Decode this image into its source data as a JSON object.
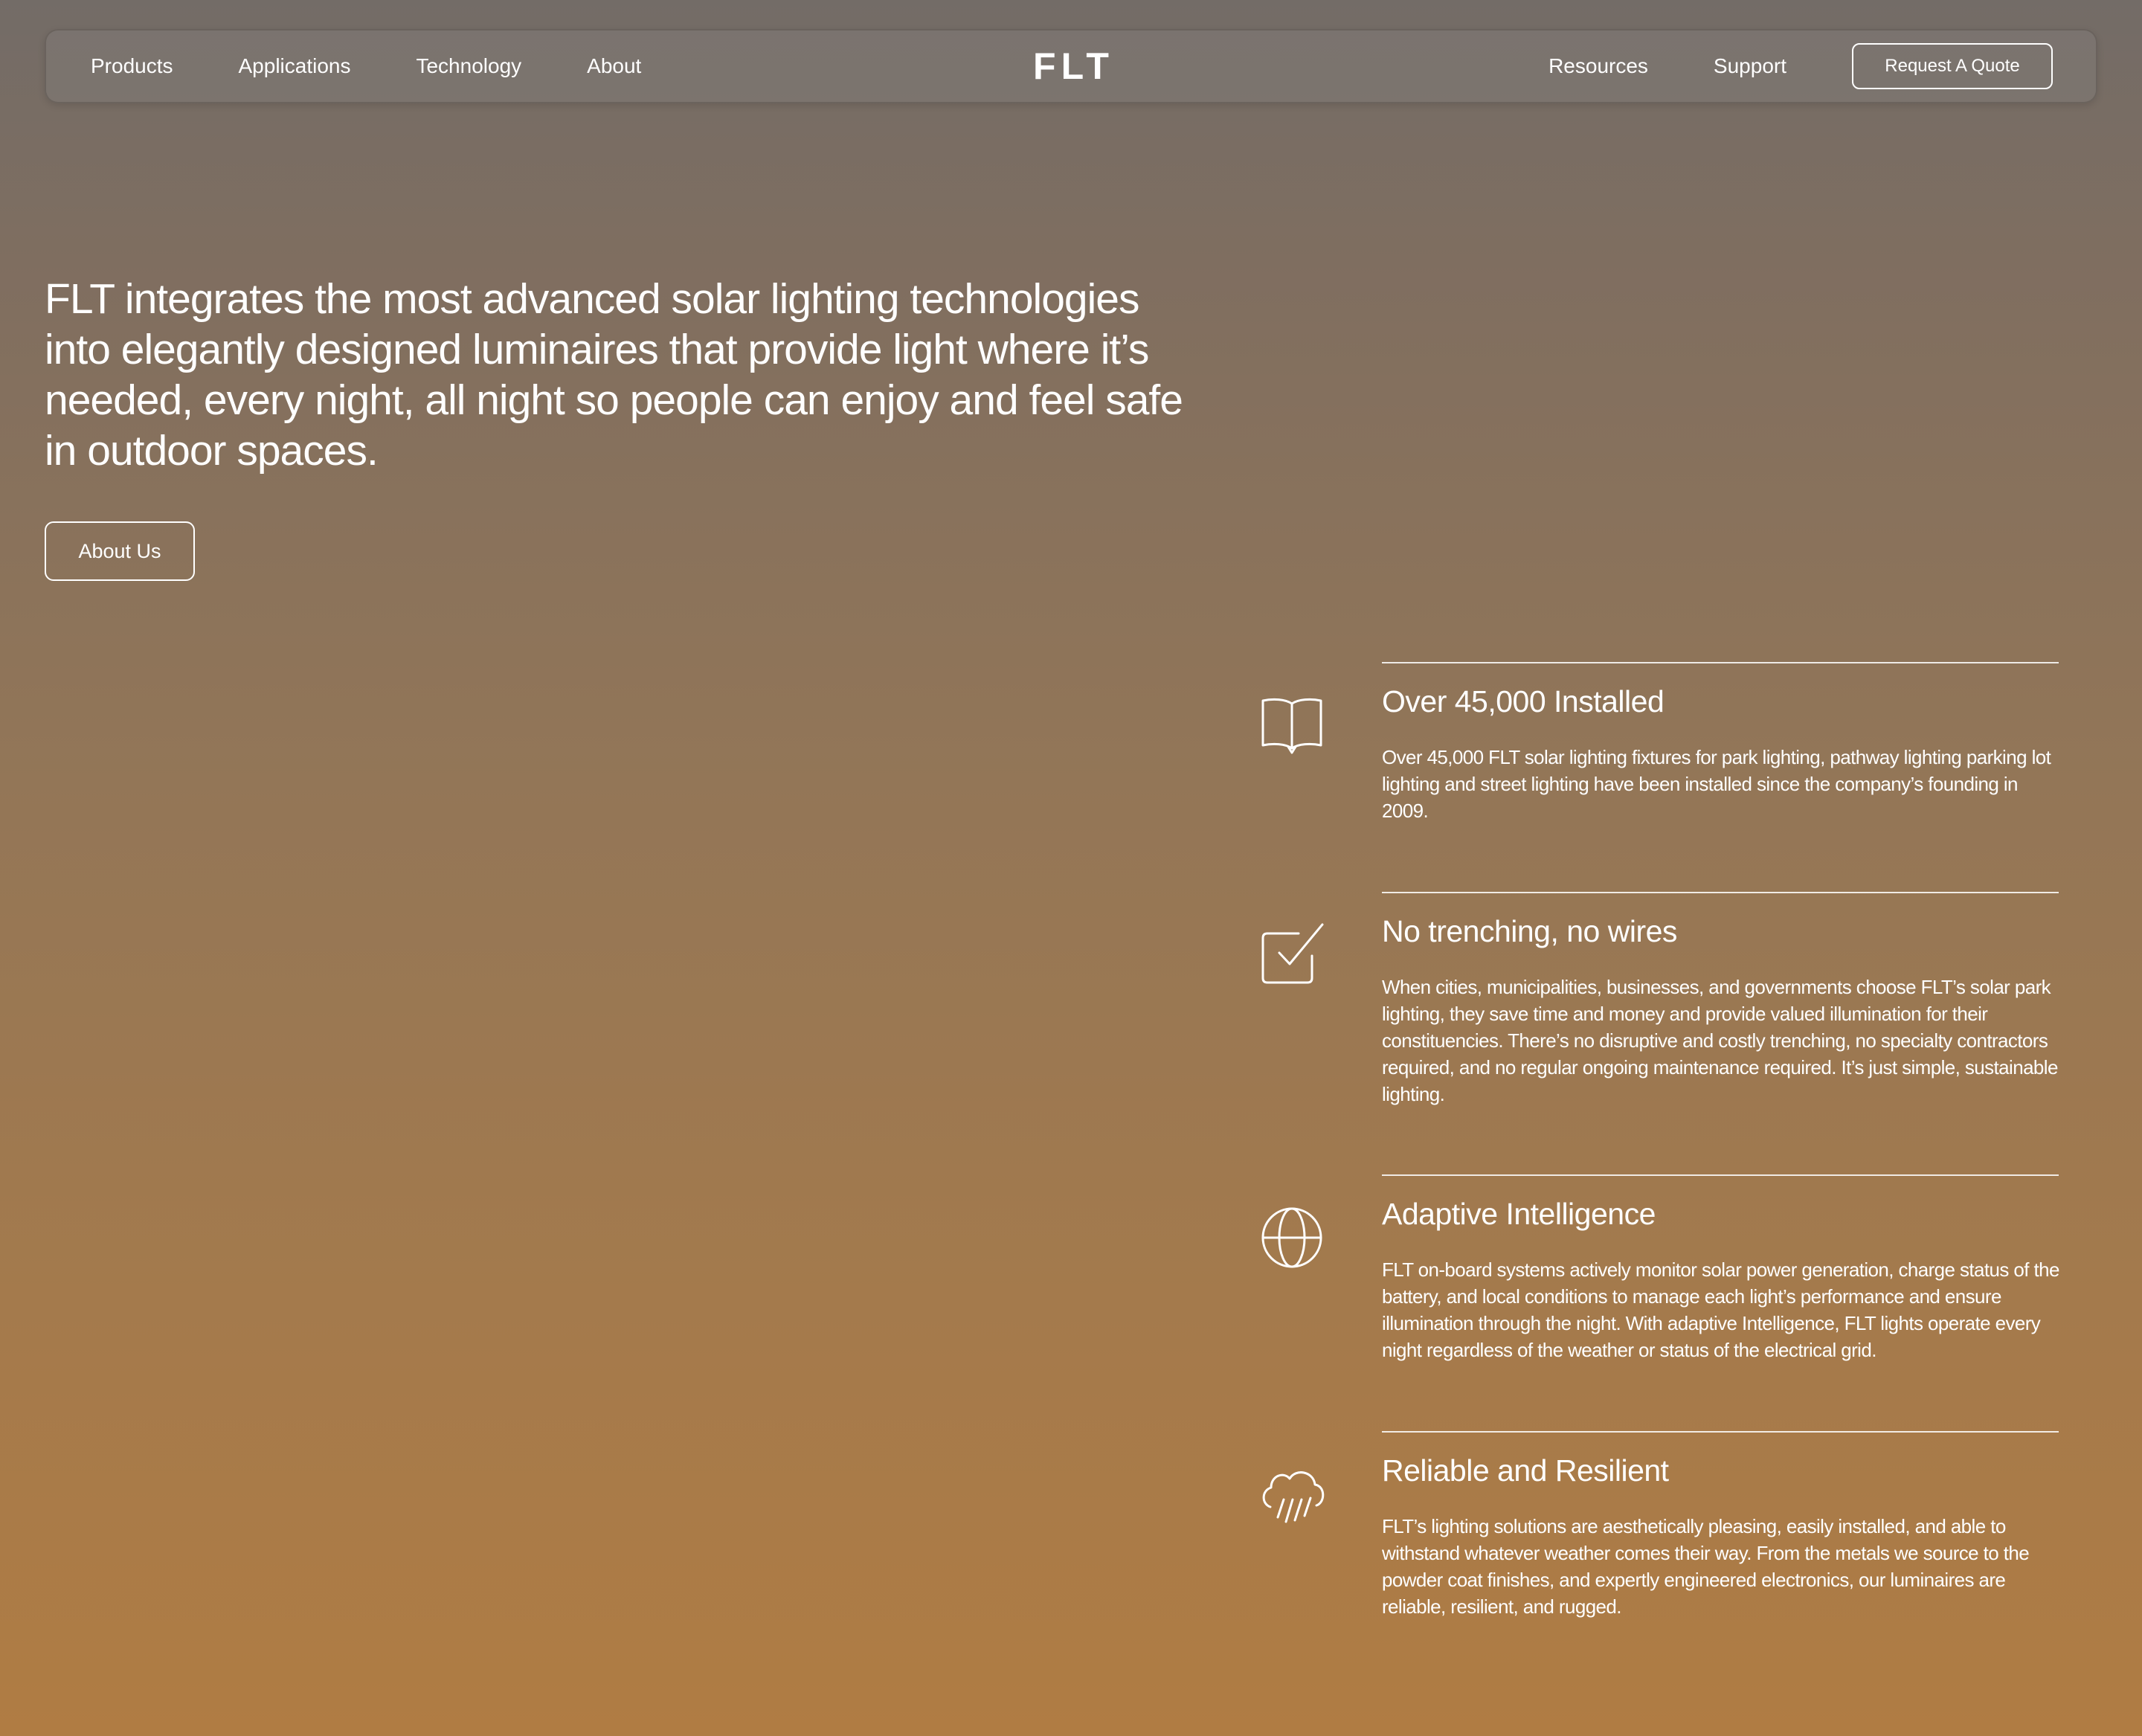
{
  "nav": {
    "logo": "FLT",
    "left_links": [
      "Products",
      "Applications",
      "Technology",
      "About"
    ],
    "right_links": [
      "Resources",
      "Support"
    ],
    "cta": "Request A Quote"
  },
  "hero": {
    "text": "FLT integrates the most advanced solar lighting technologies into elegantly designed luminaires that provide light where it’s needed, every night, all night so people can enjoy and feel safe in outdoor spaces.",
    "button": "About Us"
  },
  "features": [
    {
      "icon": "book-icon",
      "title": "Over 45,000 Installed",
      "body": "Over 45,000 FLT solar lighting fixtures for park lighting, pathway lighting parking lot lighting and street lighting have been installed since the company’s founding in 2009."
    },
    {
      "icon": "checkbox-icon",
      "title": "No trenching, no wires",
      "body": "When cities, municipalities, businesses, and governments choose FLT’s solar park lighting, they save time and money and provide valued illumination for their constituencies. There’s no disruptive and costly trenching, no specialty contractors required, and no regular ongoing maintenance required. It’s just simple, sustainable lighting."
    },
    {
      "icon": "globe-icon",
      "title": "Adaptive Intelligence",
      "body": "FLT on-board systems actively monitor solar power generation, charge status of the battery, and local conditions to manage each light’s performance and ensure illumination through the night. With adaptive Intelligence, FLT lights operate every night regardless of the weather or status of the electrical grid."
    },
    {
      "icon": "rain-cloud-icon",
      "title": "Reliable and Resilient",
      "body": "FLT’s lighting solutions are aesthetically pleasing, easily installed, and able to withstand whatever weather comes their way. From the metals we source to the powder coat finishes, and expertly engineered electronics, our luminaires are reliable, resilient, and rugged."
    }
  ]
}
